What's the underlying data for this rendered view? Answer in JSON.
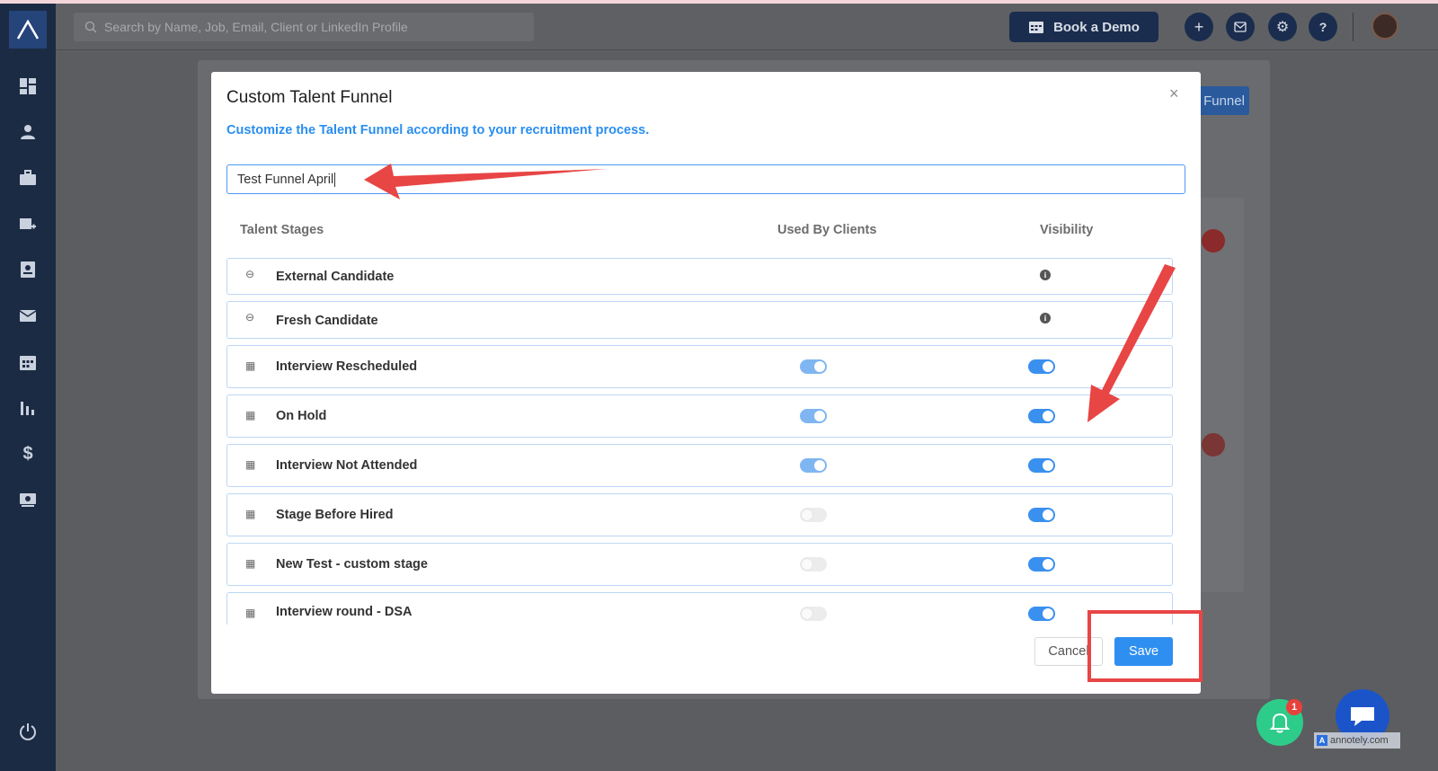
{
  "header": {
    "search_placeholder": "Search by Name, Job, Email, Client or LinkedIn Profile",
    "book_demo_label": "Book a Demo",
    "add_icon": "plus-icon",
    "mail_icon": "mail-icon",
    "settings_icon": "gear-icon",
    "help_icon": "help-icon"
  },
  "sidebar": {
    "items": [
      "dashboard-icon",
      "user-icon",
      "briefcase-icon",
      "add-job-icon",
      "contacts-icon",
      "mail-icon",
      "calendar-icon",
      "analytics-icon",
      "dollar-icon",
      "billing-icon",
      "power-icon"
    ]
  },
  "background": {
    "funnel_button_label": "Funnel"
  },
  "modal": {
    "title": "Custom Talent Funnel",
    "subtitle": "Customize the Talent Funnel according to your recruitment process.",
    "funnel_name_value": "Test Funnel April",
    "columns": {
      "stages": "Talent Stages",
      "used_by_clients": "Used By Clients",
      "visibility": "Visibility"
    },
    "stages": [
      {
        "name": "External Candidate",
        "icon": "minus-circle-icon",
        "used_by_clients": null,
        "visibility": "info"
      },
      {
        "name": "Fresh Candidate",
        "icon": "minus-circle-icon",
        "used_by_clients": null,
        "visibility": "info"
      },
      {
        "name": "Interview Rescheduled",
        "icon": "drag-handle-icon",
        "used_by_clients": "on-disabled",
        "visibility": "on"
      },
      {
        "name": "On Hold",
        "icon": "drag-handle-icon",
        "used_by_clients": "on-disabled",
        "visibility": "on"
      },
      {
        "name": "Interview Not Attended",
        "icon": "drag-handle-icon",
        "used_by_clients": "on-disabled",
        "visibility": "on"
      },
      {
        "name": "Stage Before Hired",
        "icon": "drag-handle-icon",
        "used_by_clients": "off",
        "visibility": "on"
      },
      {
        "name": "New Test - custom stage",
        "icon": "drag-handle-icon",
        "used_by_clients": "off",
        "visibility": "on"
      },
      {
        "name": "Interview round - DSA",
        "icon": "drag-handle-icon",
        "used_by_clients": "off",
        "visibility": "on"
      }
    ],
    "cancel_label": "Cancel",
    "save_label": "Save",
    "close_glyph": "×"
  },
  "widgets": {
    "notification_count": "1",
    "watermark": "annotely.com"
  },
  "colors": {
    "accent": "#2f8ff0",
    "annotation_red": "#e84545",
    "sidebar_bg": "#1c2b44"
  }
}
